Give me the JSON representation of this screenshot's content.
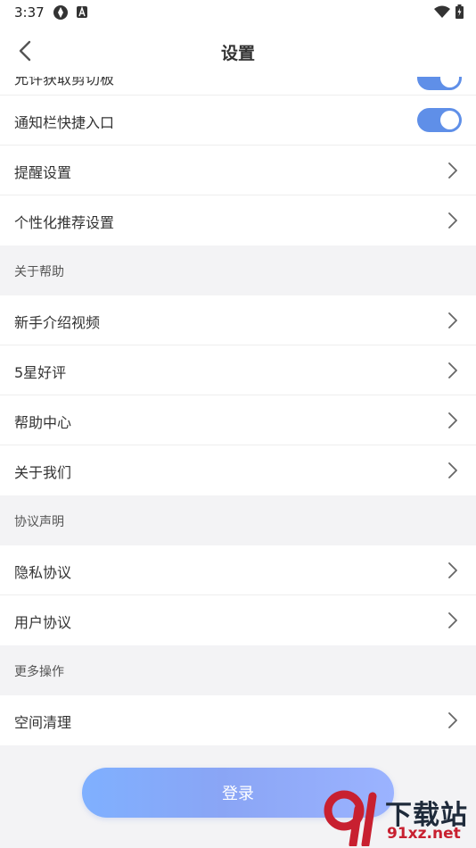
{
  "status_bar": {
    "time": "3:37",
    "icons": [
      "settings-app-icon",
      "a-notification-icon",
      "wifi-icon",
      "battery-icon"
    ]
  },
  "header": {
    "title": "设置",
    "back_icon": "chevron-left-icon"
  },
  "settings": {
    "partial_row": {
      "label": "允许获取剪切板",
      "toggle_on": true
    },
    "notify_entry": {
      "label": "通知栏快捷入口",
      "toggle_on": true
    },
    "reminder": {
      "label": "提醒设置"
    },
    "personalized": {
      "label": "个性化推荐设置"
    }
  },
  "sections": {
    "help": {
      "title": "关于帮助",
      "items": [
        {
          "label": "新手介绍视频"
        },
        {
          "label": "5星好评"
        },
        {
          "label": "帮助中心"
        },
        {
          "label": "关于我们"
        }
      ]
    },
    "agreements": {
      "title": "协议声明",
      "items": [
        {
          "label": "隐私协议"
        },
        {
          "label": "用户协议"
        }
      ]
    },
    "more": {
      "title": "更多操作",
      "items": [
        {
          "label": "空间清理"
        }
      ]
    }
  },
  "login_button": {
    "label": "登录"
  },
  "watermark": {
    "text": "下载站",
    "url": "91xz.net"
  },
  "colors": {
    "accent": "#5f8fe8",
    "background": "#f3f3f5",
    "login_gradient_start": "#7fb0ff",
    "login_gradient_end": "#9bb3ff",
    "watermark_red": "#c82030"
  }
}
